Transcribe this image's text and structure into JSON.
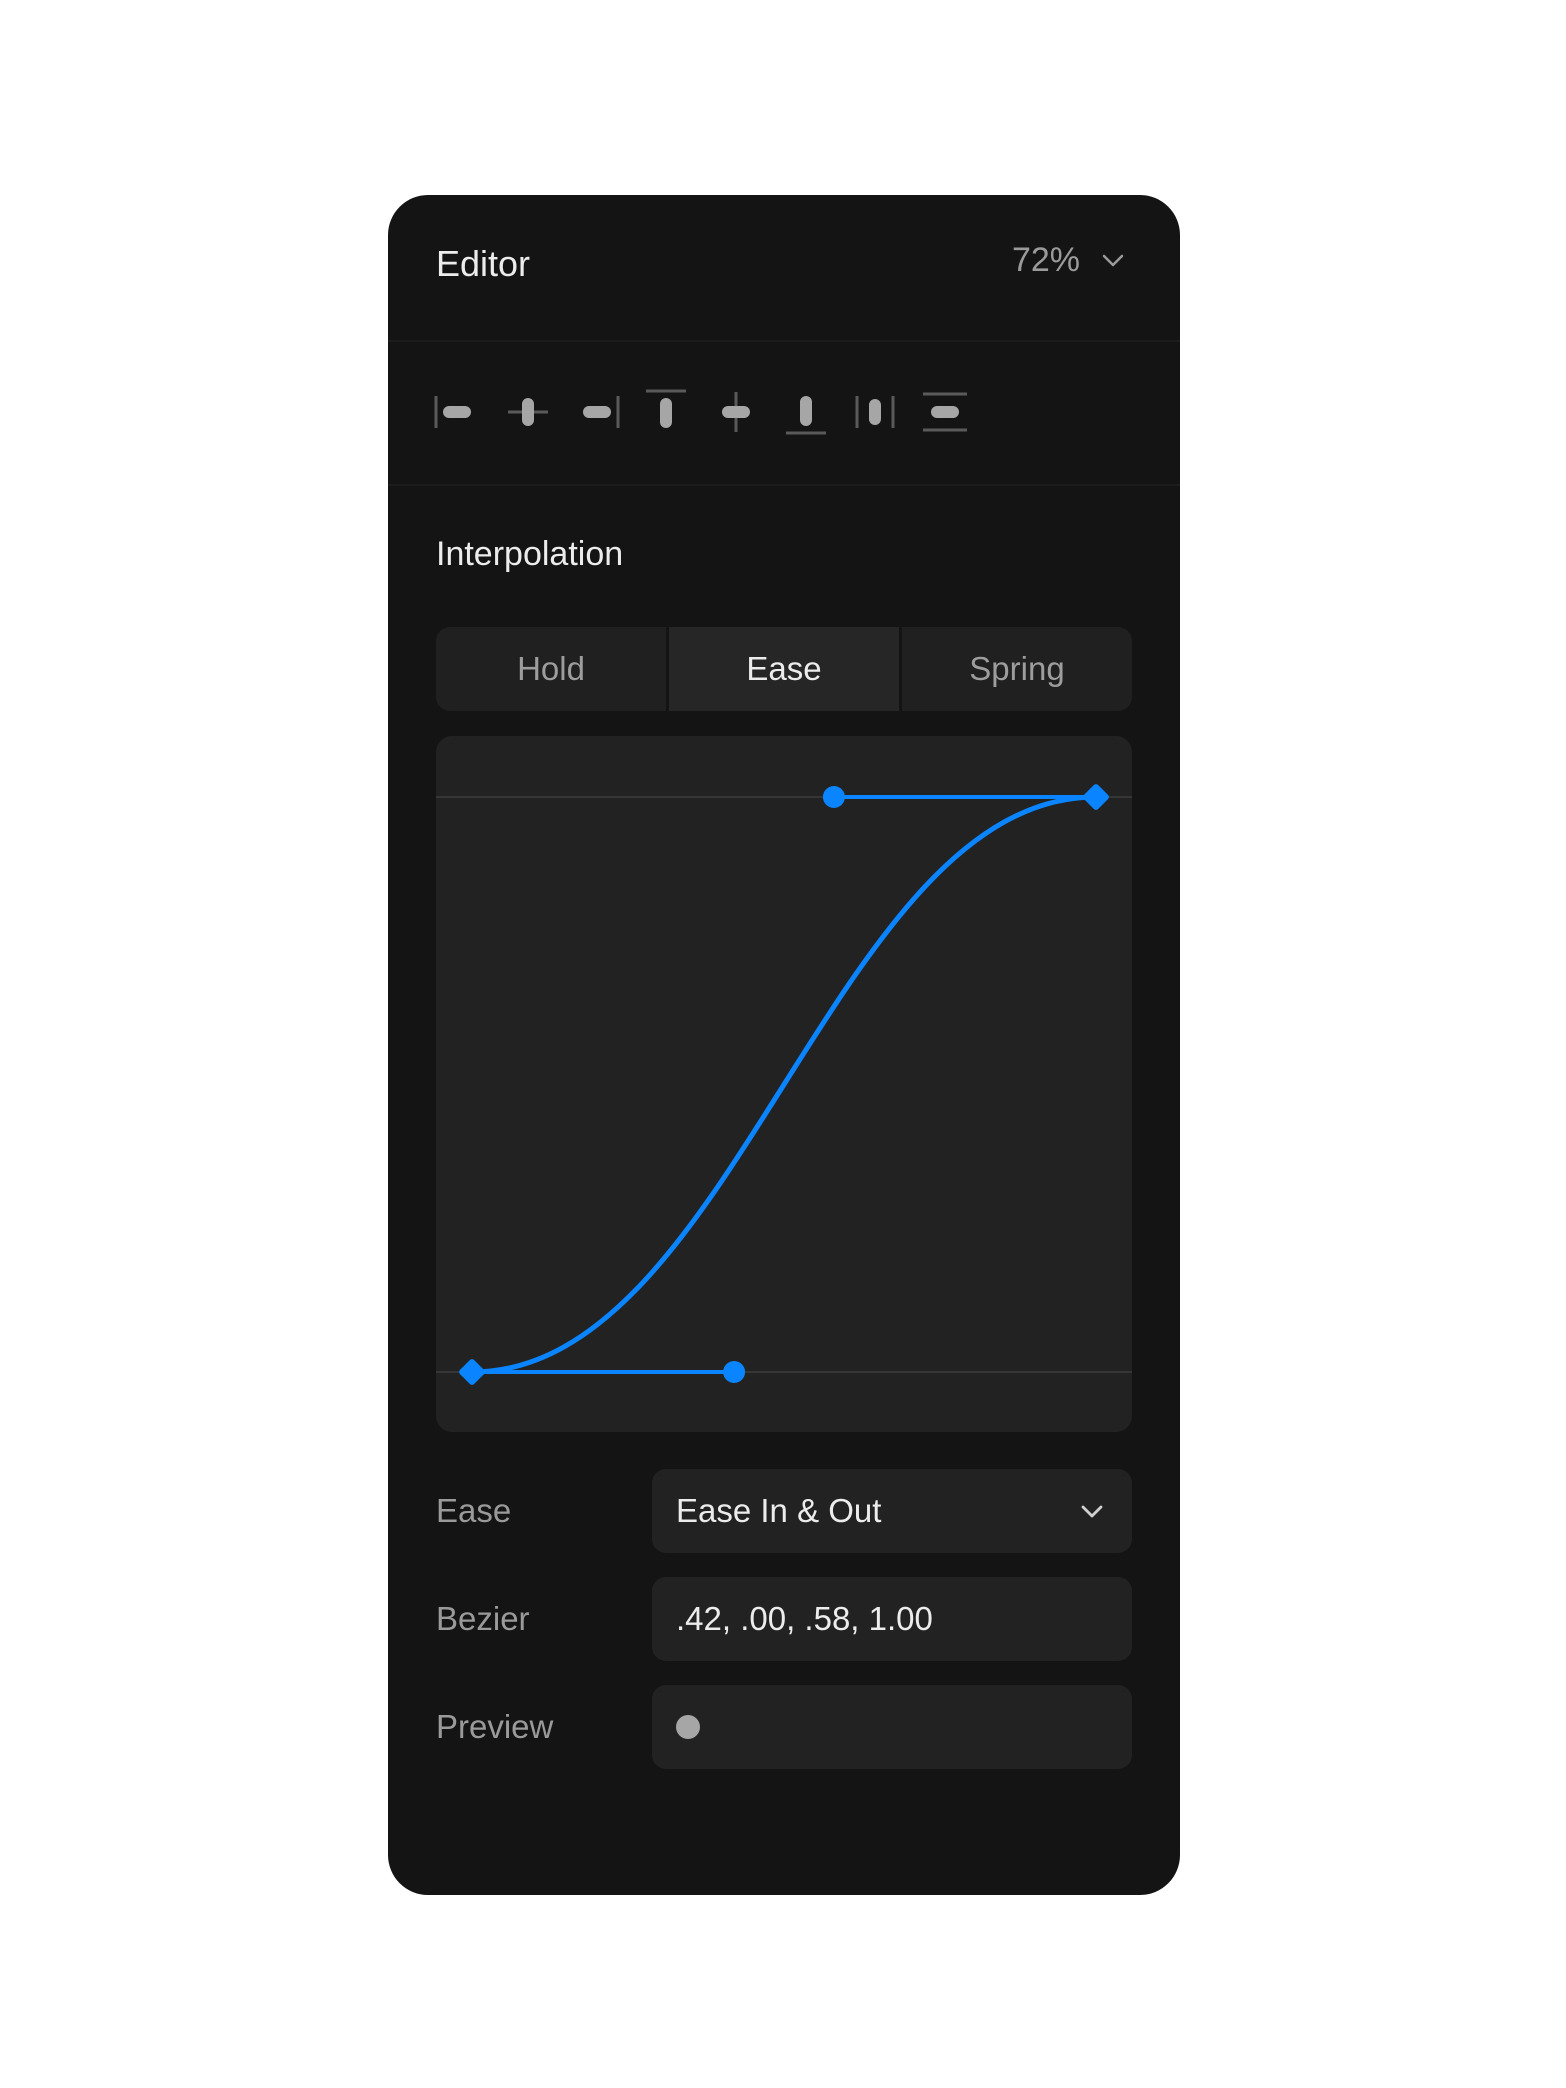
{
  "header": {
    "title": "Editor",
    "zoom": "72%"
  },
  "toolbar": {
    "tools": [
      {
        "name": "align-left-icon"
      },
      {
        "name": "align-horizontal-center-icon"
      },
      {
        "name": "align-right-icon"
      },
      {
        "name": "align-top-icon"
      },
      {
        "name": "align-vertical-center-icon"
      },
      {
        "name": "align-bottom-icon"
      },
      {
        "name": "distribute-horizontal-icon"
      },
      {
        "name": "distribute-vertical-icon"
      }
    ]
  },
  "interpolation": {
    "title": "Interpolation",
    "tabs": [
      "Hold",
      "Ease",
      "Spring"
    ],
    "active_tab": "Ease"
  },
  "curve": {
    "bezier": [
      0.42,
      0.0,
      0.58,
      1.0
    ],
    "accent": "#0a84ff"
  },
  "fields": {
    "ease_label": "Ease",
    "ease_value": "Ease In & Out",
    "bezier_label": "Bezier",
    "bezier_value": ".42, .00, .58, 1.00",
    "preview_label": "Preview"
  }
}
